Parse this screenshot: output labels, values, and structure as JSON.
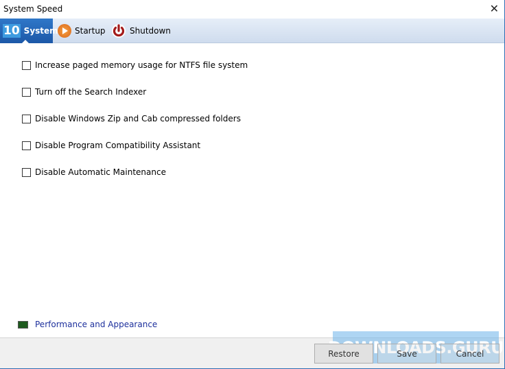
{
  "window": {
    "title": "System Speed"
  },
  "tabs": [
    {
      "label": "System",
      "badge": "10"
    },
    {
      "label": "Startup"
    },
    {
      "label": "Shutdown"
    }
  ],
  "options": [
    {
      "label": "Increase paged memory usage for NTFS file system",
      "checked": false
    },
    {
      "label": "Turn off the Search Indexer",
      "checked": false
    },
    {
      "label": "Disable Windows Zip and Cab compressed folders",
      "checked": false
    },
    {
      "label": "Disable Program Compatibility Assistant",
      "checked": false
    },
    {
      "label": "Disable Automatic Maintenance",
      "checked": false
    }
  ],
  "link": {
    "label": "Performance and Appearance"
  },
  "buttons": {
    "restore": "Restore",
    "save": "Save",
    "cancel": "Cancel"
  },
  "watermark": {
    "left": "DOWNLOADS",
    "right": ".GURU"
  }
}
